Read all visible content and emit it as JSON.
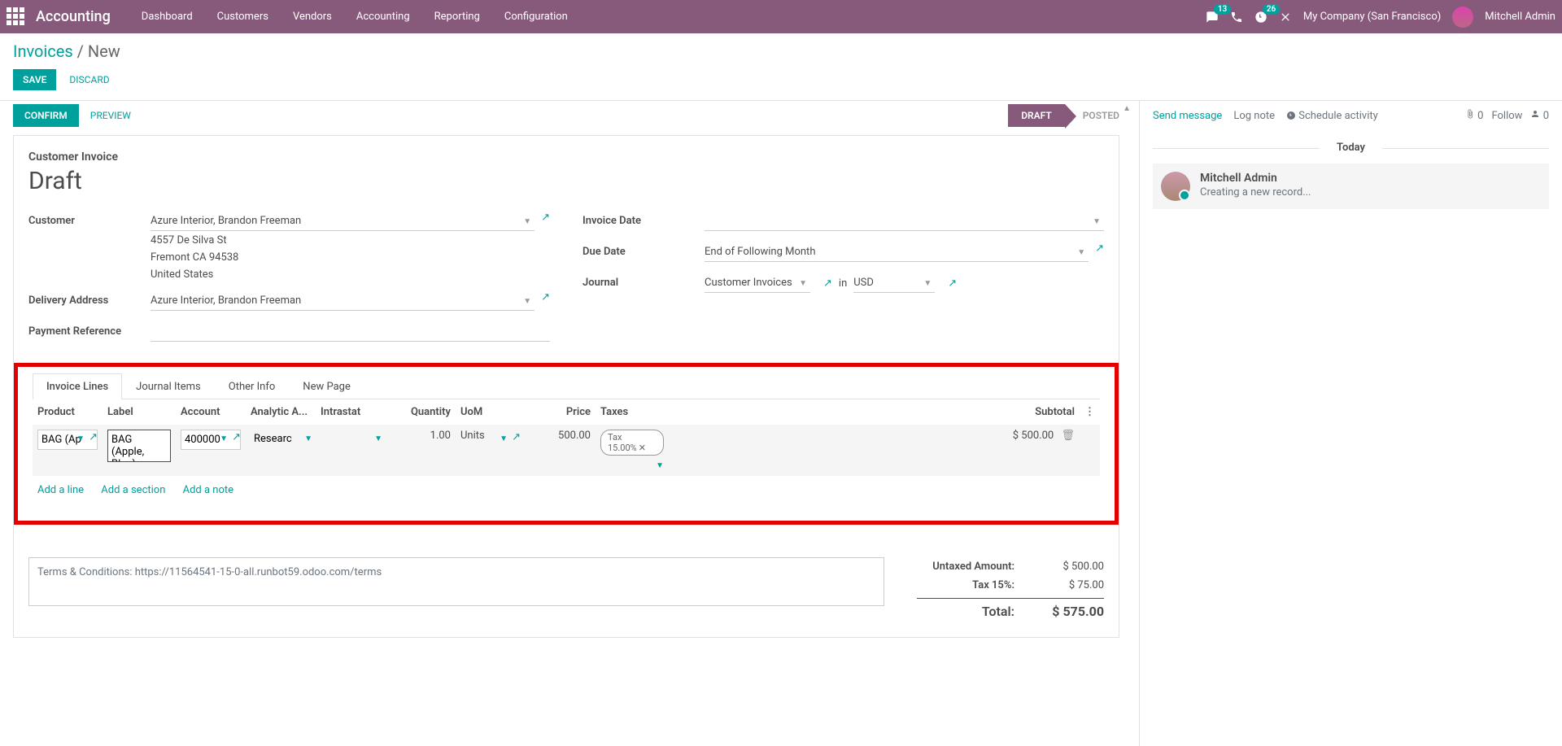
{
  "topbar": {
    "brand": "Accounting",
    "menu": [
      "Dashboard",
      "Customers",
      "Vendors",
      "Accounting",
      "Reporting",
      "Configuration"
    ],
    "messages_badge": "13",
    "activities_badge": "26",
    "company": "My Company (San Francisco)",
    "username": "Mitchell Admin"
  },
  "breadcrumb": {
    "root": "Invoices",
    "current": "New"
  },
  "actions": {
    "save": "Save",
    "discard": "Discard",
    "confirm": "Confirm",
    "preview": "Preview"
  },
  "status": {
    "draft": "Draft",
    "posted": "Posted"
  },
  "form": {
    "title_small": "Customer Invoice",
    "title_big": "Draft",
    "labels": {
      "customer": "Customer",
      "delivery": "Delivery Address",
      "payment_ref": "Payment Reference",
      "invoice_date": "Invoice Date",
      "due_date": "Due Date",
      "journal": "Journal",
      "in": "in"
    },
    "fields": {
      "customer": "Azure Interior, Brandon Freeman",
      "address1": "4557 De Silva St",
      "address2": "Fremont CA 94538",
      "address3": "United States",
      "delivery": "Azure Interior, Brandon Freeman",
      "invoice_date": "",
      "due_date": "End of Following Month",
      "journal": "Customer Invoices",
      "currency": "USD"
    }
  },
  "tabs": [
    "Invoice Lines",
    "Journal Items",
    "Other Info",
    "New Page"
  ],
  "table": {
    "headers": {
      "product": "Product",
      "label": "Label",
      "account": "Account",
      "analytic": "Analytic A...",
      "intrastat": "Intrastat",
      "quantity": "Quantity",
      "uom": "UoM",
      "price": "Price",
      "taxes": "Taxes",
      "subtotal": "Subtotal"
    },
    "row": {
      "product": "BAG (Ap",
      "label": "BAG (Apple, Blue)",
      "account": "400000",
      "analytic": "Researc",
      "quantity": "1.00",
      "uom": "Units",
      "price": "500.00",
      "tax": "Tax 15.00%",
      "subtotal": "$ 500.00"
    },
    "add": {
      "line": "Add a line",
      "section": "Add a section",
      "note": "Add a note"
    }
  },
  "terms": "Terms & Conditions: https://11564541-15-0-all.runbot59.odoo.com/terms",
  "totals": {
    "untaxed_label": "Untaxed Amount:",
    "untaxed_val": "$ 500.00",
    "tax_label": "Tax 15%:",
    "tax_val": "$ 75.00",
    "total_label": "Total:",
    "total_val": "$ 575.00"
  },
  "chatter": {
    "send": "Send message",
    "log": "Log note",
    "schedule": "Schedule activity",
    "attach_count": "0",
    "follow": "Follow",
    "follower_count": "0",
    "today": "Today",
    "entry": {
      "name": "Mitchell Admin",
      "msg": "Creating a new record..."
    }
  }
}
